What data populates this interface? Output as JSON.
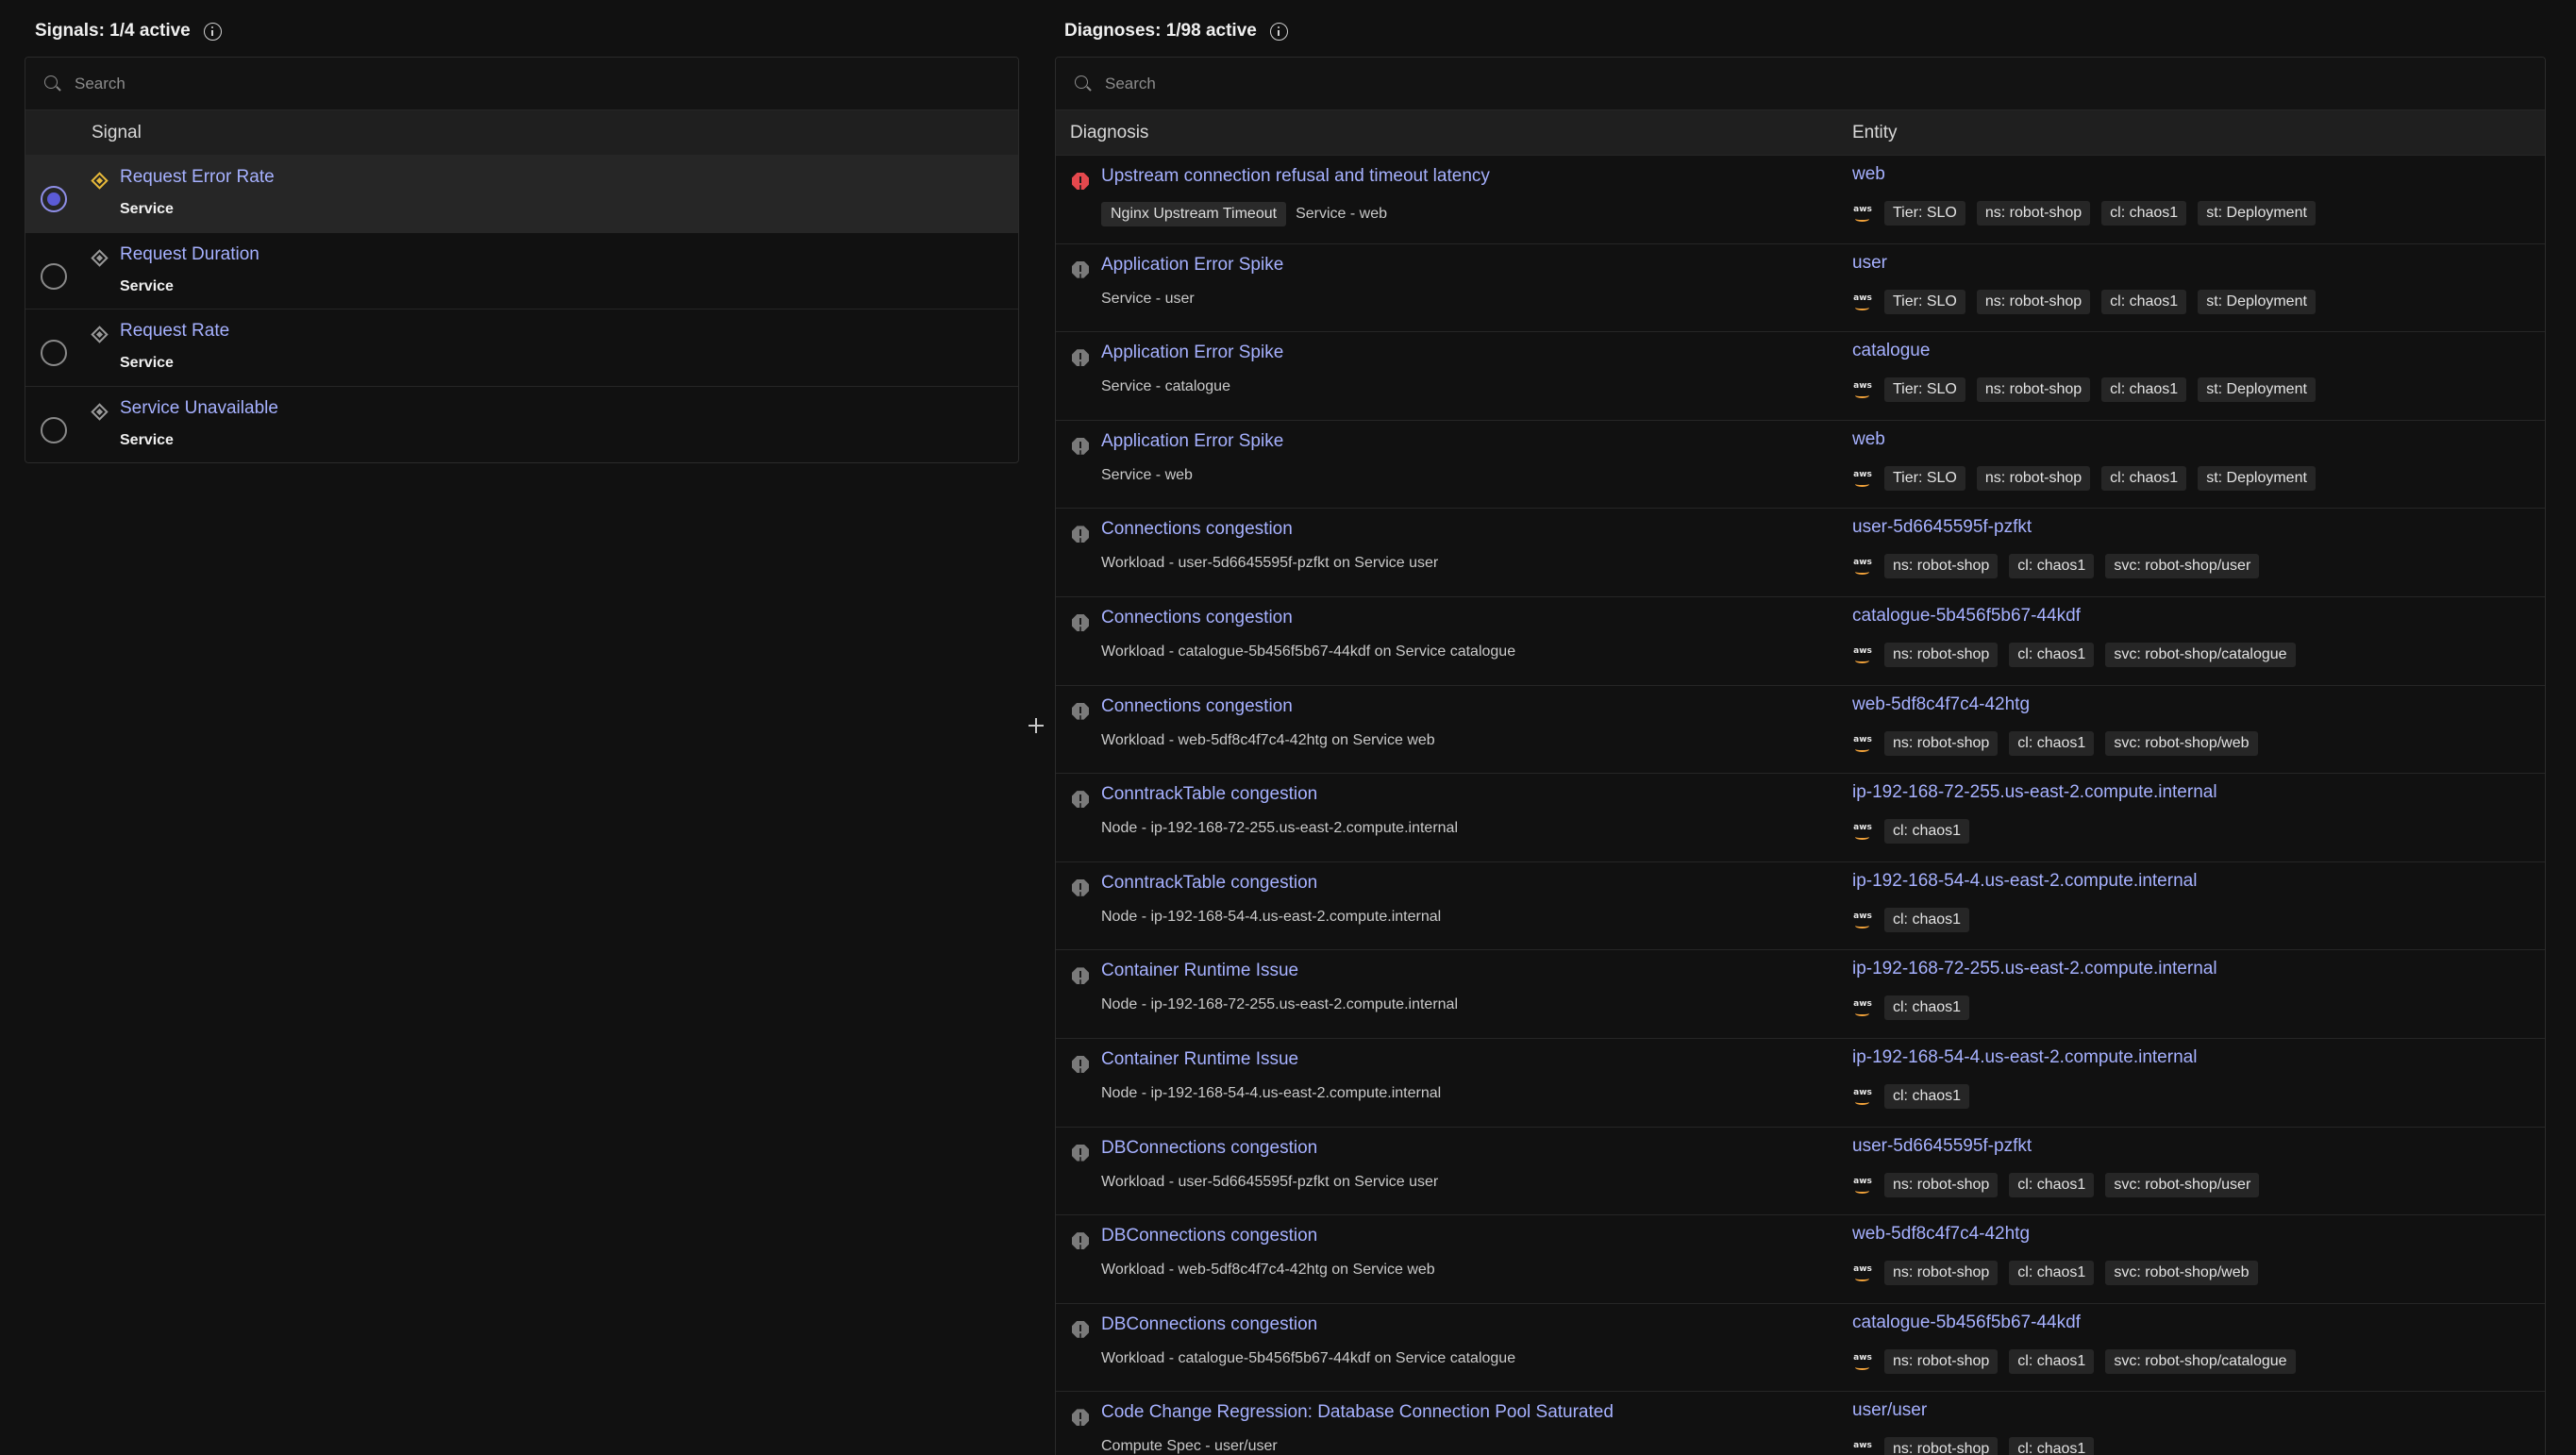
{
  "signals": {
    "title": "Signals: 1/4 active",
    "search_placeholder": "Search",
    "column": "Signal",
    "rows": [
      {
        "name": "Request Error Rate",
        "type": "Service",
        "selected": true,
        "status": "warning"
      },
      {
        "name": "Request Duration",
        "type": "Service",
        "selected": false,
        "status": "normal"
      },
      {
        "name": "Request Rate",
        "type": "Service",
        "selected": false,
        "status": "normal"
      },
      {
        "name": "Service Unavailable",
        "type": "Service",
        "selected": false,
        "status": "normal"
      }
    ]
  },
  "diagnoses": {
    "title": "Diagnoses: 1/98 active",
    "search_placeholder": "Search",
    "columns": [
      "Diagnosis",
      "Entity"
    ],
    "rows": [
      {
        "name": "Upstream connection refusal and timeout latency",
        "chip": "Nginx Upstream Timeout",
        "sub": "Service - web",
        "severity": "critical",
        "entity": "web",
        "tags": [
          "Tier: SLO",
          "ns: robot-shop",
          "cl: chaos1",
          "st: Deployment"
        ]
      },
      {
        "name": "Application Error Spike",
        "chip": "",
        "sub": "Service - user",
        "severity": "inactive",
        "entity": "user",
        "tags": [
          "Tier: SLO",
          "ns: robot-shop",
          "cl: chaos1",
          "st: Deployment"
        ]
      },
      {
        "name": "Application Error Spike",
        "chip": "",
        "sub": "Service - catalogue",
        "severity": "inactive",
        "entity": "catalogue",
        "tags": [
          "Tier: SLO",
          "ns: robot-shop",
          "cl: chaos1",
          "st: Deployment"
        ]
      },
      {
        "name": "Application Error Spike",
        "chip": "",
        "sub": "Service - web",
        "severity": "inactive",
        "entity": "web",
        "tags": [
          "Tier: SLO",
          "ns: robot-shop",
          "cl: chaos1",
          "st: Deployment"
        ]
      },
      {
        "name": "Connections congestion",
        "chip": "",
        "sub": "Workload - user-5d6645595f-pzfkt on Service user",
        "severity": "inactive",
        "entity": "user-5d6645595f-pzfkt",
        "tags": [
          "ns: robot-shop",
          "cl: chaos1",
          "svc: robot-shop/user"
        ]
      },
      {
        "name": "Connections congestion",
        "chip": "",
        "sub": "Workload - catalogue-5b456f5b67-44kdf on Service catalogue",
        "severity": "inactive",
        "entity": "catalogue-5b456f5b67-44kdf",
        "tags": [
          "ns: robot-shop",
          "cl: chaos1",
          "svc: robot-shop/catalogue"
        ]
      },
      {
        "name": "Connections congestion",
        "chip": "",
        "sub": "Workload - web-5df8c4f7c4-42htg on Service web",
        "severity": "inactive",
        "entity": "web-5df8c4f7c4-42htg",
        "tags": [
          "ns: robot-shop",
          "cl: chaos1",
          "svc: robot-shop/web"
        ]
      },
      {
        "name": "ConntrackTable congestion",
        "chip": "",
        "sub": "Node - ip-192-168-72-255.us-east-2.compute.internal",
        "severity": "inactive",
        "entity": "ip-192-168-72-255.us-east-2.compute.internal",
        "tags": [
          "cl: chaos1"
        ]
      },
      {
        "name": "ConntrackTable congestion",
        "chip": "",
        "sub": "Node - ip-192-168-54-4.us-east-2.compute.internal",
        "severity": "inactive",
        "entity": "ip-192-168-54-4.us-east-2.compute.internal",
        "tags": [
          "cl: chaos1"
        ]
      },
      {
        "name": "Container Runtime Issue",
        "chip": "",
        "sub": "Node - ip-192-168-72-255.us-east-2.compute.internal",
        "severity": "inactive",
        "entity": "ip-192-168-72-255.us-east-2.compute.internal",
        "tags": [
          "cl: chaos1"
        ]
      },
      {
        "name": "Container Runtime Issue",
        "chip": "",
        "sub": "Node - ip-192-168-54-4.us-east-2.compute.internal",
        "severity": "inactive",
        "entity": "ip-192-168-54-4.us-east-2.compute.internal",
        "tags": [
          "cl: chaos1"
        ]
      },
      {
        "name": "DBConnections congestion",
        "chip": "",
        "sub": "Workload - user-5d6645595f-pzfkt on Service user",
        "severity": "inactive",
        "entity": "user-5d6645595f-pzfkt",
        "tags": [
          "ns: robot-shop",
          "cl: chaos1",
          "svc: robot-shop/user"
        ]
      },
      {
        "name": "DBConnections congestion",
        "chip": "",
        "sub": "Workload - web-5df8c4f7c4-42htg on Service web",
        "severity": "inactive",
        "entity": "web-5df8c4f7c4-42htg",
        "tags": [
          "ns: robot-shop",
          "cl: chaos1",
          "svc: robot-shop/web"
        ]
      },
      {
        "name": "DBConnections congestion",
        "chip": "",
        "sub": "Workload - catalogue-5b456f5b67-44kdf on Service catalogue",
        "severity": "inactive",
        "entity": "catalogue-5b456f5b67-44kdf",
        "tags": [
          "ns: robot-shop",
          "cl: chaos1",
          "svc: robot-shop/catalogue"
        ]
      },
      {
        "name": "Code Change Regression: Database Connection Pool Saturated",
        "chip": "",
        "sub": "Compute Spec - user/user",
        "severity": "inactive",
        "entity": "user/user",
        "tags": [
          "ns: robot-shop",
          "cl: chaos1"
        ]
      }
    ]
  },
  "icons": {
    "info": "info-icon",
    "search": "search-icon",
    "aws": "aws-icon",
    "resize": "move-cursor-icon"
  },
  "aws_label": "aws",
  "colors": {
    "background": "#111111",
    "link": "#a6b1ff",
    "warning": "#e7b93a",
    "critical": "#e5484d",
    "radio_active": "#5b5bd6"
  }
}
